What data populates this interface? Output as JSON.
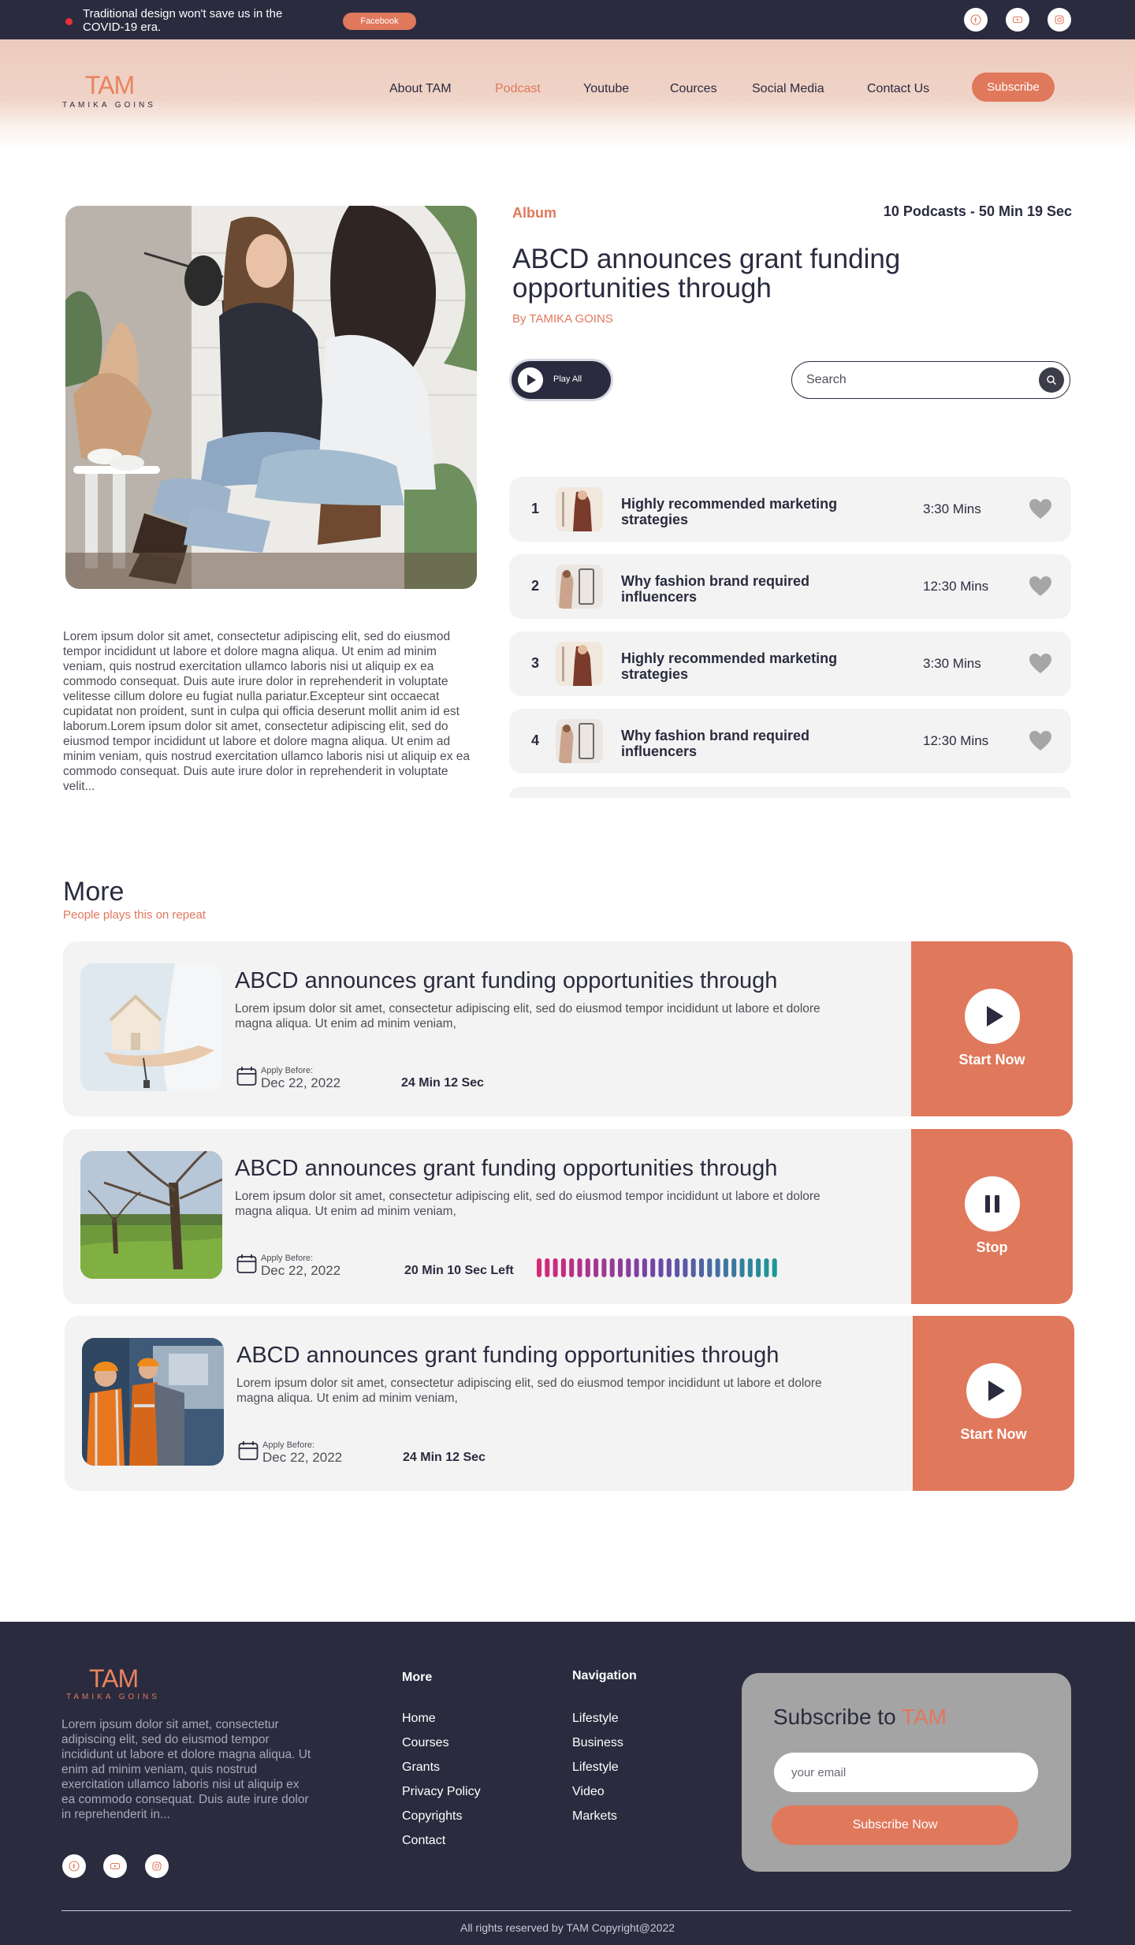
{
  "topbar": {
    "announcement": "Traditional design won't save us in the COVID-19 era.",
    "pill_label": "Facebook",
    "social_icons": [
      "facebook-icon",
      "youtube-icon",
      "instagram-icon"
    ]
  },
  "brand": {
    "logo": "TAM",
    "tagline": "TAMIKA GOINS"
  },
  "nav": {
    "items": [
      "About TAM",
      "Podcast",
      "Youtube",
      "Cources",
      "Social Media",
      "Contact Us"
    ],
    "active": "Podcast",
    "subscribe_label": "Subscribe"
  },
  "album": {
    "label": "Album",
    "meta": "10 Podcasts - 50 Min 19 Sec",
    "title": "ABCD announces grant funding opportunities through",
    "author": "By TAMIKA GOINS",
    "play_all_label": "Play All",
    "search_placeholder": "Search",
    "description": "Lorem ipsum dolor sit amet, consectetur adipiscing elit, sed do eiusmod tempor incididunt ut labore et dolore magna aliqua. Ut enim ad minim veniam, quis nostrud exercitation ullamco laboris nisi ut aliquip ex ea commodo consequat. Duis aute irure dolor in reprehenderit in voluptate velitesse cillum dolore eu fugiat nulla pariatur.Excepteur sint occaecat cupidatat non proident, sunt in culpa qui officia deserunt mollit anim id est laborum.Lorem ipsum dolor sit amet, consectetur adipiscing elit, sed do eiusmod tempor incididunt ut labore et dolore magna aliqua. Ut enim ad minim veniam, quis nostrud exercitation ullamco laboris nisi ut aliquip ex ea commodo consequat. Duis aute irure dolor in reprehenderit in voluptate velit...",
    "tracks": [
      {
        "num": "1",
        "title": "Highly recommended marketing strategies",
        "duration": "3:30 Mins"
      },
      {
        "num": "2",
        "title": "Why fashion brand required influencers",
        "duration": "12:30 Mins"
      },
      {
        "num": "3",
        "title": "Highly recommended marketing strategies",
        "duration": "3:30 Mins"
      },
      {
        "num": "4",
        "title": "Why fashion brand required influencers",
        "duration": "12:30 Mins"
      }
    ]
  },
  "more": {
    "title": "More",
    "subtitle": "People plays this on repeat",
    "episodes": [
      {
        "title": "ABCD announces grant funding opportunities through",
        "desc": "Lorem ipsum dolor sit amet, consectetur adipiscing elit, sed do eiusmod tempor incididunt ut labore et dolore magna aliqua. Ut enim ad minim veniam,",
        "apply_label": "Apply Before:",
        "date": "Dec 22, 2022",
        "duration": "24 Min 12 Sec",
        "action": "Start Now"
      },
      {
        "title": "ABCD announces grant funding opportunities through",
        "desc": "Lorem ipsum dolor sit amet, consectetur adipiscing elit, sed do eiusmod tempor incididunt ut labore et dolore magna aliqua. Ut enim ad minim veniam,",
        "apply_label": "Apply Before:",
        "date": "Dec 22, 2022",
        "duration": "20 Min 10 Sec Left",
        "action": "Stop"
      },
      {
        "title": "ABCD announces grant funding opportunities through",
        "desc": "Lorem ipsum dolor sit amet, consectetur adipiscing elit, sed do eiusmod tempor incididunt ut labore et dolore magna aliqua. Ut enim ad minim veniam,",
        "apply_label": "Apply Before:",
        "date": "Dec 22, 2022",
        "duration": "24 Min 12 Sec",
        "action": "Start Now"
      }
    ]
  },
  "footer": {
    "about": "Lorem ipsum dolor sit amet, consectetur adipiscing elit, sed do eiusmod tempor incididunt ut labore et dolore magna aliqua. Ut enim ad minim veniam, quis nostrud exercitation ullamco laboris nisi ut aliquip ex ea commodo consequat. Duis aute irure dolor in reprehenderit in...",
    "more_heading": "More",
    "more_links": [
      "Home",
      "Courses",
      "Grants",
      "Privacy Policy",
      "Copyrights",
      "Contact"
    ],
    "nav_heading": "Navigation",
    "nav_links": [
      "Lifestyle",
      "Business",
      "Lifestyle",
      "Video",
      "Markets"
    ],
    "subscribe_title": "Subscribe to",
    "subscribe_accent": "TAM",
    "email_placeholder": "your email",
    "subscribe_button": "Subscribe Now",
    "copyright": "All rights reserved by TAM Copyright@2022"
  },
  "colors": {
    "navy": "#2a2b3f",
    "accent": "#e0785c",
    "card_bg": "#f3f3f3"
  }
}
